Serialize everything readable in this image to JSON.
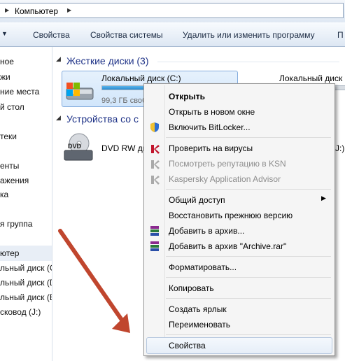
{
  "address_bar": {
    "crumb": "Компьютер"
  },
  "toolbar": {
    "items": [
      "Свойства",
      "Свойства системы",
      "Удалить или изменить программу",
      "П"
    ]
  },
  "nav": {
    "items": [
      "ное",
      "жи",
      "ние места",
      "й стол",
      "теки",
      "енты",
      "ажения",
      "ка",
      "я группа",
      "ютер",
      "льный диск (C",
      "льный диск (D",
      "льный диск (E:",
      "сковод (J:)"
    ]
  },
  "main": {
    "hdd_group": "Жесткие диски (3)",
    "drive_c": {
      "label": "Локальный диск (C:)",
      "free": "99,3 ГБ своб",
      "fill": 0.55
    },
    "drive_d": {
      "label": "Локальный диск"
    },
    "removable_group": "Устройства со с",
    "dvd": {
      "label": "DVD RW ди",
      "icon_text": "DVD"
    },
    "j_label": "(J:)"
  },
  "context_menu": {
    "open": "Открыть",
    "open_new": "Открыть в новом окне",
    "bitlocker": "Включить BitLocker...",
    "scan": "Проверить на вирусы",
    "ksn": "Посмотреть репутацию в KSN",
    "kaa": "Kaspersky Application Advisor",
    "share": "Общий доступ",
    "restore": "Восстановить прежнюю версию",
    "add_archive": "Добавить в архив...",
    "add_archive_rar": "Добавить в архив \"Archive.rar\"",
    "format": "Форматировать...",
    "copy": "Копировать",
    "shortcut": "Создать ярлык",
    "rename": "Переименовать",
    "properties": "Свойства"
  },
  "colors": {
    "arrow": "#c0462e",
    "accent": "#1e3287"
  }
}
